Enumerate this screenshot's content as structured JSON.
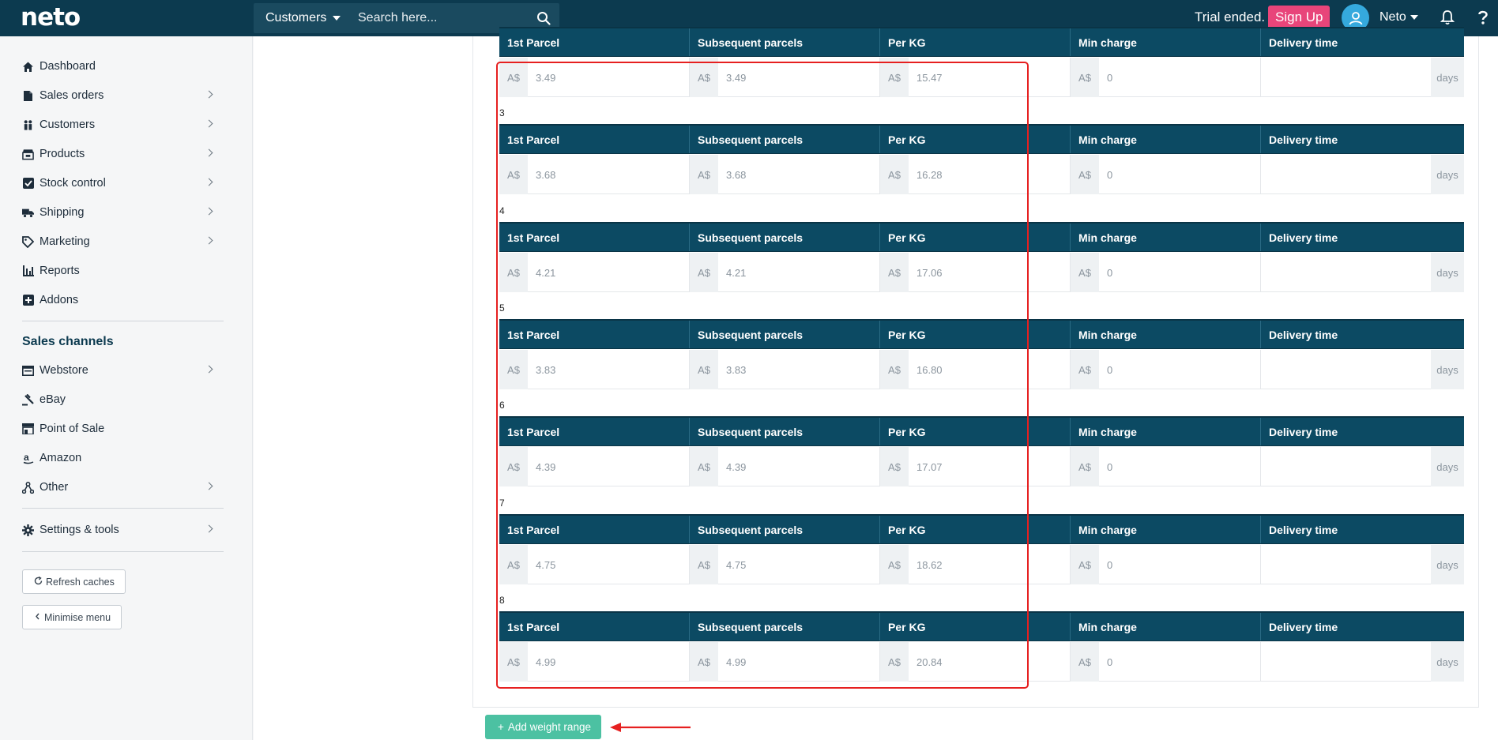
{
  "app": {
    "logo": "neto"
  },
  "header": {
    "search_scope": "Customers",
    "search_placeholder": "Search here...",
    "trial_text": "Trial ended.",
    "signup_label": "Sign Up",
    "user_name": "Neto"
  },
  "sidebar": {
    "items": [
      {
        "label": "Dashboard",
        "icon": "home-icon",
        "has_children": false
      },
      {
        "label": "Sales orders",
        "icon": "document-icon",
        "has_children": true
      },
      {
        "label": "Customers",
        "icon": "users-icon",
        "has_children": true
      },
      {
        "label": "Products",
        "icon": "store-icon",
        "has_children": true
      },
      {
        "label": "Stock control",
        "icon": "checkbox-icon",
        "has_children": true
      },
      {
        "label": "Shipping",
        "icon": "truck-icon",
        "has_children": true
      },
      {
        "label": "Marketing",
        "icon": "tag-icon",
        "has_children": true
      },
      {
        "label": "Reports",
        "icon": "bar-chart-icon",
        "has_children": false
      },
      {
        "label": "Addons",
        "icon": "plus-square-icon",
        "has_children": false
      }
    ],
    "channels_title": "Sales channels",
    "channels": [
      {
        "label": "Webstore",
        "icon": "window-icon",
        "has_children": true
      },
      {
        "label": "eBay",
        "icon": "gavel-icon",
        "has_children": false
      },
      {
        "label": "Point of Sale",
        "icon": "shop-icon",
        "has_children": false
      },
      {
        "label": "Amazon",
        "icon": "amazon-icon",
        "has_children": false
      },
      {
        "label": "Other",
        "icon": "network-icon",
        "has_children": true
      }
    ],
    "settings_label": "Settings & tools",
    "refresh_label": "Refresh caches",
    "minimise_label": "Minimise menu"
  },
  "table": {
    "headers": [
      "1st Parcel",
      "Subsequent parcels",
      "Per KG",
      "Min charge",
      "Delivery time"
    ],
    "currency": "A$",
    "days_label": "days",
    "ranges": [
      {
        "label": "",
        "first": "3.49",
        "subsequent": "3.49",
        "per_kg": "15.47",
        "min": "0"
      },
      {
        "label": "3",
        "first": "3.68",
        "subsequent": "3.68",
        "per_kg": "16.28",
        "min": "0"
      },
      {
        "label": "4",
        "first": "4.21",
        "subsequent": "4.21",
        "per_kg": "17.06",
        "min": "0"
      },
      {
        "label": "5",
        "first": "3.83",
        "subsequent": "3.83",
        "per_kg": "16.80",
        "min": "0"
      },
      {
        "label": "6",
        "first": "4.39",
        "subsequent": "4.39",
        "per_kg": "17.07",
        "min": "0"
      },
      {
        "label": "7",
        "first": "4.75",
        "subsequent": "4.75",
        "per_kg": "18.62",
        "min": "0"
      },
      {
        "label": "8",
        "first": "4.99",
        "subsequent": "4.99",
        "per_kg": "20.84",
        "min": "0"
      }
    ],
    "add_range_label": "Add weight range"
  },
  "colors": {
    "header_bg": "#0c3a4f",
    "table_header_bg": "#0c4a63",
    "accent_pink": "#e8457a",
    "accent_green": "#4cc1a2",
    "annotation_red": "#e62020"
  }
}
